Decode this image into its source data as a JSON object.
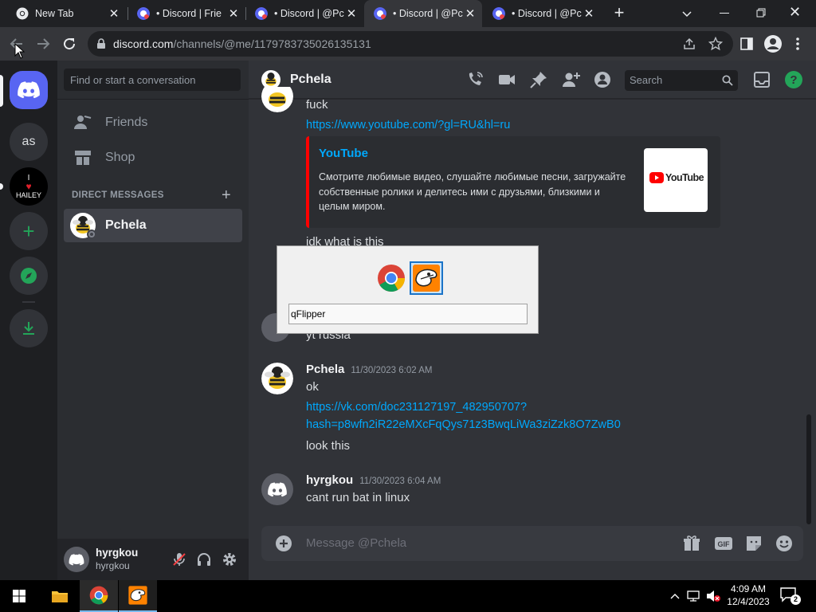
{
  "browser": {
    "tabs": [
      {
        "title": "New Tab",
        "active": false
      },
      {
        "title": "• Discord | Frie",
        "active": false
      },
      {
        "title": "• Discord | @Pc",
        "active": false
      },
      {
        "title": "• Discord | @Pc",
        "active": true
      },
      {
        "title": "• Discord | @Pc",
        "active": false
      }
    ],
    "url_host": "discord.com",
    "url_path": "/channels/@me/1179783735026135131"
  },
  "discord": {
    "guilds": [
      {
        "label": "as"
      }
    ],
    "hailey_text": "HAILEY",
    "hailey_i": "I",
    "dm_search_placeholder": "Find or start a conversation",
    "nav": {
      "friends": "Friends",
      "shop": "Shop"
    },
    "dm_section_label": "DIRECT MESSAGES",
    "dm_list": [
      {
        "name": "Pchela"
      }
    ],
    "user_panel": {
      "name": "hyrgkou",
      "tag": "hyrgkou"
    },
    "chat": {
      "title": "Pchela",
      "search_placeholder": "Search",
      "composer_placeholder": "Message @Pchela",
      "messages": [
        {
          "text": "fuck"
        },
        {
          "link": "https://www.youtube.com/?gl=RU&hl=ru"
        },
        {
          "embed": {
            "provider": "YouTube",
            "description": "Смотрите любимые видео, слушайте любимые песни, загружайте собственные ролики и делитесь ими с друзьями, близкими и целым миром.",
            "thumb_text": "YouTube"
          }
        },
        {
          "text": "idk what is this"
        },
        {
          "text": "yt russia"
        },
        {
          "author": "Pchela",
          "time": "11/30/2023 6:02 AM",
          "text": "ok",
          "link_line1": "https://vk.com/doc231127197_482950707?",
          "link_line2": "hash=p8wfn2iR22eMXcFqQys71z3BwqLiWa3ziZzk8O7ZwB0",
          "text2": "look this"
        },
        {
          "author": "hyrgkou",
          "time": "11/30/2023 6:04 AM",
          "text": "cant run bat in linux"
        }
      ]
    }
  },
  "alt_tab": {
    "apps": [
      "chrome-icon",
      "qflipper-icon"
    ],
    "selected_name": "qFlipper"
  },
  "taskbar": {
    "time": "4:09 AM",
    "date": "12/4/2023",
    "notifications_count": "2"
  },
  "colors": {
    "discord_blurple": "#5865f2",
    "discord_green": "#23a559",
    "link": "#00a8fc",
    "youtube_red": "#ff0000"
  }
}
